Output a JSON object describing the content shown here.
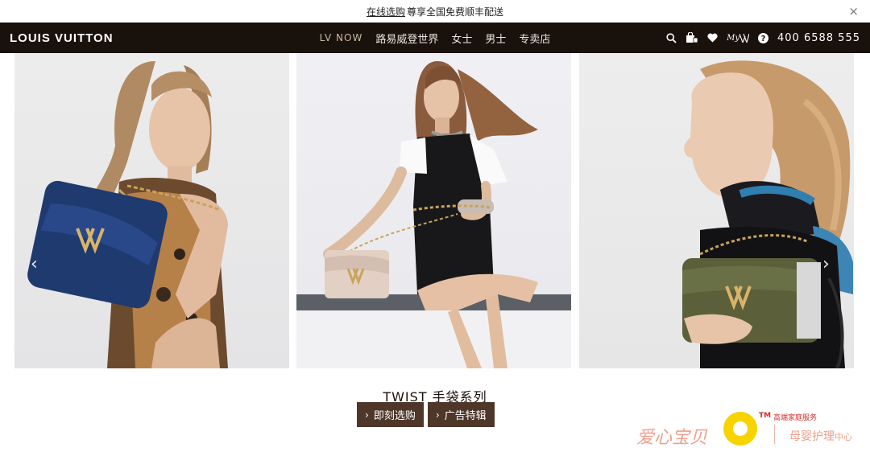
{
  "promo": {
    "link": "在线选购",
    "text": "尊享全国免费顺丰配送",
    "close": "×"
  },
  "header": {
    "logo": "LOUIS VUITTON",
    "nav": [
      "LV NOW",
      "路易威登世界",
      "女士",
      "男士",
      "专卖店"
    ],
    "myv": "My",
    "phone": "400 6588 555",
    "icons": [
      "search-icon",
      "shopping-bag-icon",
      "heart-icon",
      "my-lv-icon",
      "help-icon"
    ]
  },
  "panels": [
    "model-with-blue-twist-bag",
    "model-with-beige-twist-bag",
    "model-with-khaki-twist-bag"
  ],
  "carousel": {
    "prev": "‹",
    "next": "›"
  },
  "headline": "TWIST 手袋系列",
  "ctas": [
    {
      "chev": "›",
      "label": "即刻选购"
    },
    {
      "chev": "›",
      "label": "广告特辑"
    }
  ],
  "watermark": {
    "brand": "爱心宝贝",
    "tm": "TM",
    "service": "高端家庭服务",
    "care": "母婴护理",
    "care_small": "中心"
  },
  "colors": {
    "header_bg": "#19110b",
    "cta_bg": "#4e3629",
    "accent_gold": "#c9a35c"
  }
}
